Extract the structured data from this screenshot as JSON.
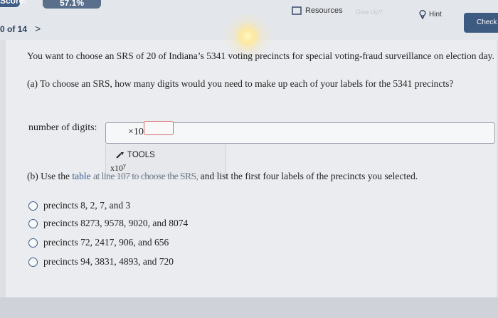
{
  "header": {
    "score_label": "Score:",
    "score_value": "57.1%",
    "question_progress": "0 of 14",
    "next_symbol": ">",
    "resources_label": "Resources",
    "ghost_label": "Give Up?",
    "hint_label": "Hint",
    "check_label": "Check A"
  },
  "question": {
    "intro": "You want to choose an SRS of 20 of Indiana’s 5341 voting precincts for special voting-fraud surveillance on election day.",
    "part_a": "(a) To choose an SRS, how many digits would you need to make up each of your labels for the 5341 precincts?",
    "answer_label": "number of digits:",
    "answer_token": "×10",
    "tools_label": "TOOLS",
    "tools_sci_base": "x10",
    "tools_sci_exp": "y",
    "part_b_start": "(b) Use the",
    "part_b_link": "table",
    "part_b_obscured": "at line 107 to choose the SRS,",
    "part_b_end": "and list the first four labels of the precincts you selected.",
    "choices": [
      "precincts 8, 2, 7, and 3",
      "precincts 8273, 9578, 9020, and 8074",
      "precincts 72, 2417, 906, and 656",
      "precincts 94, 3831, 4893, and 720"
    ]
  },
  "colors": {
    "accent": "#3d5a80",
    "slot_outline": "#cf6b63",
    "link": "#3a5a8f"
  }
}
